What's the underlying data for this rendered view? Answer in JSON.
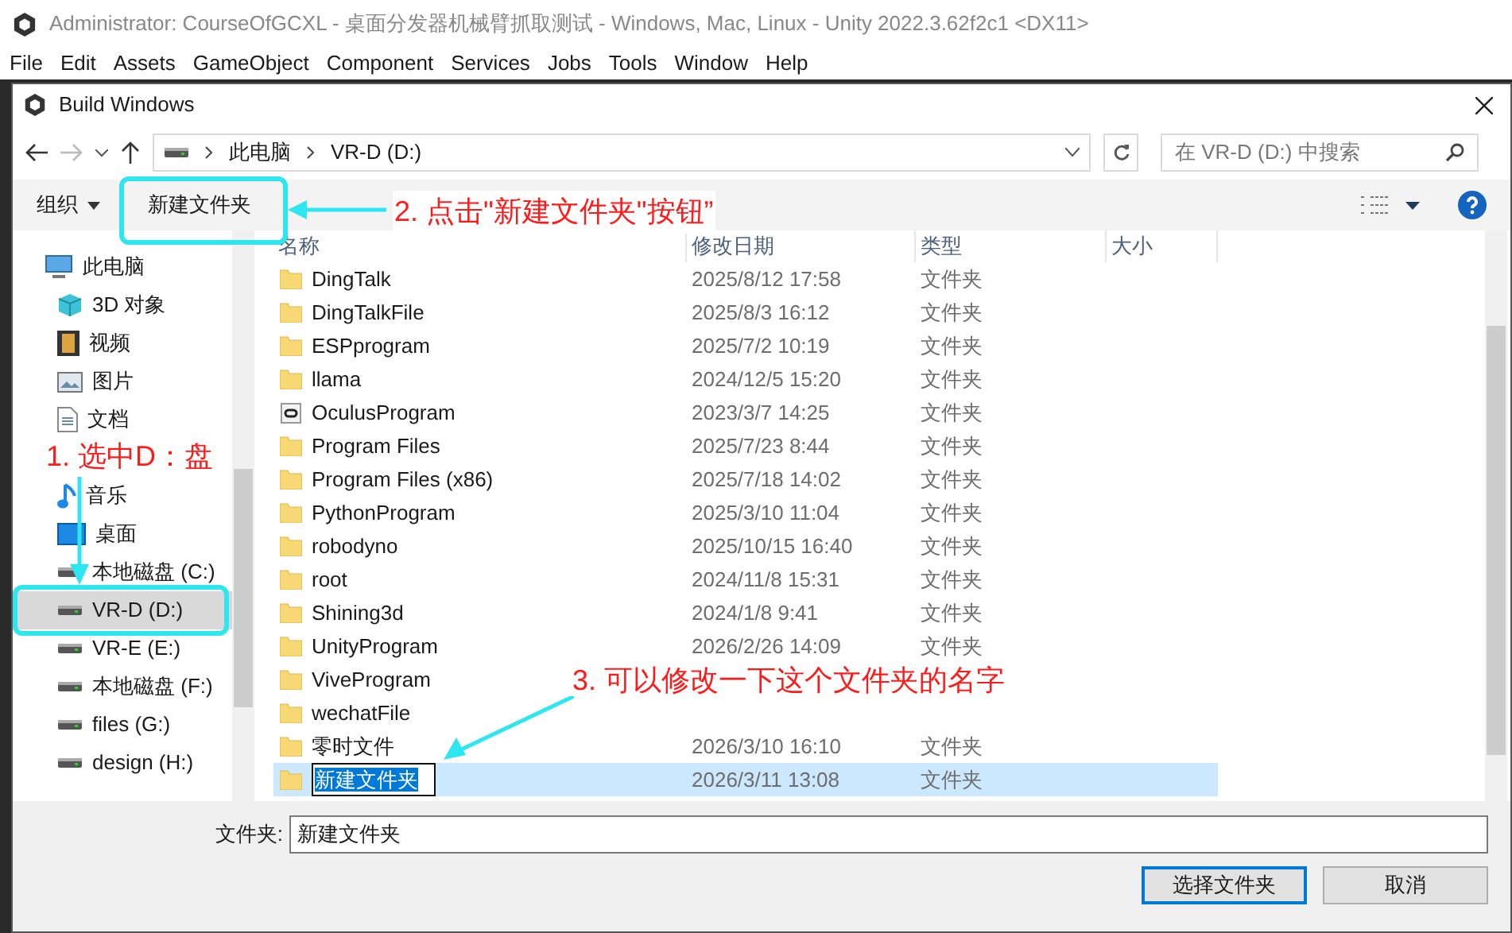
{
  "app_title": "Administrator: CourseOfGCXL - 桌面分发器机械臂抓取测试 - Windows, Mac, Linux - Unity 2022.3.62f2c1 <DX11>",
  "menu": [
    "File",
    "Edit",
    "Assets",
    "GameObject",
    "Component",
    "Services",
    "Jobs",
    "Tools",
    "Window",
    "Help"
  ],
  "dialog": {
    "title": "Build Windows",
    "breadcrumb": [
      "此电脑",
      "VR-D (D:)"
    ],
    "search": {
      "placeholder": "在 VR-D (D:) 中搜索"
    },
    "toolbar": {
      "organize": "组织",
      "new_folder": "新建文件夹"
    },
    "sidebar": [
      {
        "label": "此电脑",
        "kind": "pc",
        "selected": false
      },
      {
        "label": "3D 对象",
        "kind": "cube",
        "selected": false
      },
      {
        "label": "视频",
        "kind": "video",
        "selected": false
      },
      {
        "label": "图片",
        "kind": "picture",
        "selected": false
      },
      {
        "label": "文档",
        "kind": "doc",
        "selected": false
      },
      {
        "label": "音乐",
        "kind": "music",
        "selected": false
      },
      {
        "label": "桌面",
        "kind": "desktop",
        "selected": false
      },
      {
        "label": "本地磁盘 (C:)",
        "kind": "drive",
        "selected": false
      },
      {
        "label": "VR-D (D:)",
        "kind": "drive",
        "selected": true
      },
      {
        "label": "VR-E (E:)",
        "kind": "drive",
        "selected": false
      },
      {
        "label": "本地磁盘 (F:)",
        "kind": "drive",
        "selected": false
      },
      {
        "label": "files (G:)",
        "kind": "drive",
        "selected": false
      },
      {
        "label": "design (H:)",
        "kind": "drive",
        "selected": false
      }
    ],
    "columns": [
      "名称",
      "修改日期",
      "类型",
      "大小"
    ],
    "rows": [
      {
        "name": "DingTalk",
        "date": "2025/8/12 17:58",
        "type": "文件夹",
        "kind": "folder",
        "selected": false
      },
      {
        "name": "DingTalkFile",
        "date": "2025/8/3 16:12",
        "type": "文件夹",
        "kind": "folder",
        "selected": false
      },
      {
        "name": "ESPprogram",
        "date": "2025/7/2 10:19",
        "type": "文件夹",
        "kind": "folder",
        "selected": false
      },
      {
        "name": "llama",
        "date": "2024/12/5 15:20",
        "type": "文件夹",
        "kind": "folder",
        "selected": false
      },
      {
        "name": "OculusProgram",
        "date": "2023/3/7 14:25",
        "type": "文件夹",
        "kind": "app",
        "selected": false
      },
      {
        "name": "Program Files",
        "date": "2025/7/23 8:44",
        "type": "文件夹",
        "kind": "folder",
        "selected": false
      },
      {
        "name": "Program Files (x86)",
        "date": "2025/7/18 14:02",
        "type": "文件夹",
        "kind": "folder",
        "selected": false
      },
      {
        "name": "PythonProgram",
        "date": "2025/3/10 11:04",
        "type": "文件夹",
        "kind": "folder",
        "selected": false
      },
      {
        "name": "robodyno",
        "date": "2025/10/15 16:40",
        "type": "文件夹",
        "kind": "folder",
        "selected": false
      },
      {
        "name": "root",
        "date": "2024/11/8 15:31",
        "type": "文件夹",
        "kind": "folder",
        "selected": false
      },
      {
        "name": "Shining3d",
        "date": "2024/1/8 9:41",
        "type": "文件夹",
        "kind": "folder",
        "selected": false
      },
      {
        "name": "UnityProgram",
        "date": "2026/2/26 14:09",
        "type": "文件夹",
        "kind": "folder",
        "selected": false
      },
      {
        "name": "ViveProgram",
        "kind": "folder",
        "selected": false
      },
      {
        "name": "wechatFile",
        "kind": "folder",
        "selected": false
      },
      {
        "name": "零时文件",
        "date": "2026/3/10 16:10",
        "type": "文件夹",
        "kind": "folder",
        "selected": false
      },
      {
        "name": "新建文件夹",
        "date": "2026/3/11 13:08",
        "type": "文件夹",
        "kind": "folder",
        "selected": true
      }
    ],
    "folder_label": "文件夹:",
    "folder_value": "新建文件夹",
    "buttons": [
      "选择文件夹",
      "取消"
    ]
  },
  "annotations": [
    "1. 选中D：盘",
    "2. 点击\"新建文件夹\"按钮”",
    "3. 可以修改一下这个文件夹的名字"
  ]
}
